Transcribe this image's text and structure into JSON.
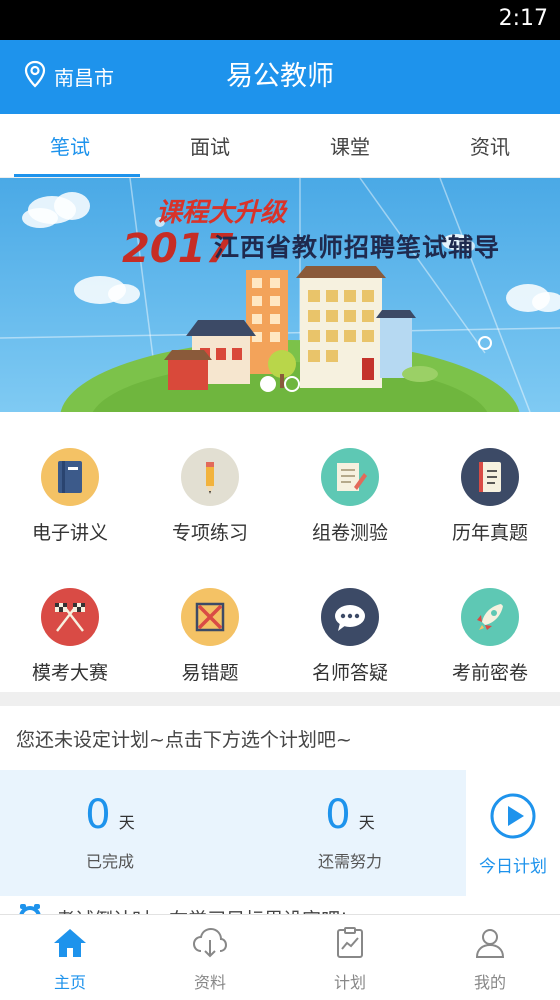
{
  "status_bar": {
    "time": "2:17"
  },
  "header": {
    "location": "南昌市",
    "title": "易公教师"
  },
  "tabs": [
    {
      "label": "笔试",
      "active": true
    },
    {
      "label": "面试",
      "active": false
    },
    {
      "label": "课堂",
      "active": false
    },
    {
      "label": "资讯",
      "active": false
    }
  ],
  "banner": {
    "line1": "课程大升级",
    "year": "2017",
    "line2": "江西省教师招聘笔试辅导"
  },
  "grid": [
    {
      "label": "电子讲义",
      "icon": "book-icon",
      "color": "#f4c265"
    },
    {
      "label": "专项练习",
      "icon": "pencil-icon",
      "color": "#e2dfd2"
    },
    {
      "label": "组卷测验",
      "icon": "paper-edit-icon",
      "color": "#5ec8b4"
    },
    {
      "label": "历年真题",
      "icon": "exam-book-icon",
      "color": "#3c4a66"
    },
    {
      "label": "模考大赛",
      "icon": "race-flags-icon",
      "color": "#d94b45"
    },
    {
      "label": "易错题",
      "icon": "error-mark-icon",
      "color": "#f4c265"
    },
    {
      "label": "名师答疑",
      "icon": "chat-bubble-icon",
      "color": "#3c4a66"
    },
    {
      "label": "考前密卷",
      "icon": "rocket-icon",
      "color": "#5ec8b4"
    }
  ],
  "plan": {
    "prompt": "您还未设定计划~点击下方选个计划吧~",
    "completed": {
      "value": "0",
      "unit": "天",
      "label": "已完成"
    },
    "remaining": {
      "value": "0",
      "unit": "天",
      "label": "还需努力"
    },
    "today_label": "今日计划"
  },
  "ticker": {
    "text": "考试倒计时 · 在学习目标里设定吧!"
  },
  "bottom_nav": [
    {
      "label": "主页",
      "icon": "home-icon",
      "active": true
    },
    {
      "label": "资料",
      "icon": "cloud-download-icon",
      "active": false
    },
    {
      "label": "计划",
      "icon": "plan-chart-icon",
      "active": false
    },
    {
      "label": "我的",
      "icon": "user-icon",
      "active": false
    }
  ],
  "colors": {
    "primary": "#1e93ec",
    "banner_sky": "#57b4ec",
    "grass": "#7cc24a"
  }
}
